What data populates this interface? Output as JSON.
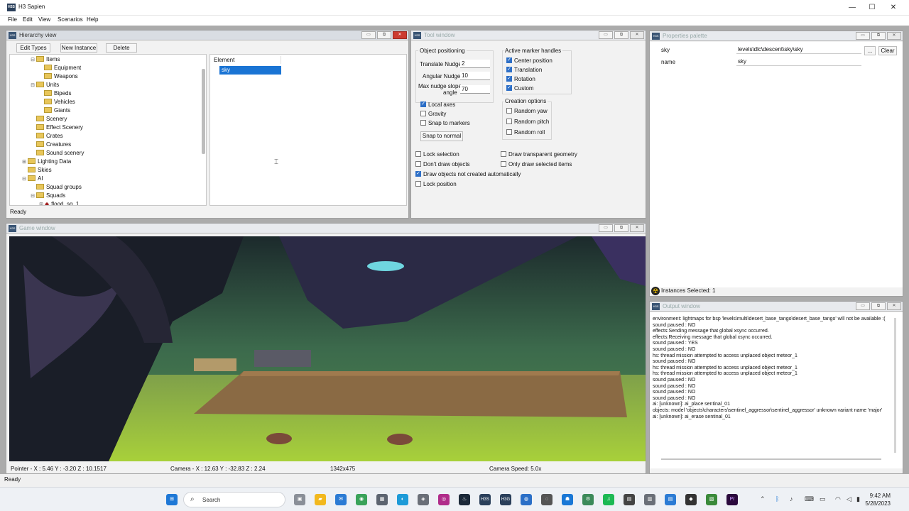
{
  "app": {
    "title": "H3 Sapien",
    "icon_text": "H3S",
    "ctrl_min": "—",
    "ctrl_max": "☐",
    "ctrl_close": "✕"
  },
  "menu": [
    "File",
    "Edit",
    "View",
    "Scenarios",
    "Help"
  ],
  "hierarchy": {
    "title": "Hierarchy view",
    "buttons": {
      "edit_types": "Edit Types",
      "new_instance": "New Instance",
      "delete": "Delete"
    },
    "tree": [
      {
        "label": "Items",
        "exp": "⊟"
      },
      {
        "label": "Equipment",
        "exp": ""
      },
      {
        "label": "Weapons",
        "exp": ""
      },
      {
        "label": "Units",
        "exp": "⊟"
      },
      {
        "label": "Bipeds",
        "exp": ""
      },
      {
        "label": "Vehicles",
        "exp": ""
      },
      {
        "label": "Giants",
        "exp": ""
      },
      {
        "label": "Scenery",
        "exp": ""
      },
      {
        "label": "Effect Scenery",
        "exp": ""
      },
      {
        "label": "Crates",
        "exp": ""
      },
      {
        "label": "Creatures",
        "exp": ""
      },
      {
        "label": "Sound scenery",
        "exp": ""
      },
      {
        "label": "Lighting Data",
        "exp": "⊞"
      },
      {
        "label": "Skies",
        "exp": ""
      },
      {
        "label": "AI",
        "exp": "⊟"
      },
      {
        "label": "Squad groups",
        "exp": ""
      },
      {
        "label": "Squads",
        "exp": "⊟"
      },
      {
        "label": "flood_sq_1",
        "exp": "⊞"
      }
    ],
    "element_header": "Element",
    "selected_element": "sky",
    "status": "Ready"
  },
  "tool": {
    "title": "Tool window",
    "object_positioning": "Object positioning",
    "translate_nudge_label": "Translate Nudge",
    "translate_nudge_value": "2",
    "angular_nudge_label": "Angular Nudge",
    "angular_nudge_value": "10",
    "max_nudge_label_1": "Max nudge slope",
    "max_nudge_label_2": "angle",
    "max_nudge_value": "70",
    "local_axes": "Local axes",
    "gravity": "Gravity",
    "snap_to_markers": "Snap to markers",
    "snap_to_normal": "Snap to normal",
    "active_marker_handles": "Active marker handles",
    "center_position": "Center position",
    "translation": "Translation",
    "rotation": "Rotation",
    "custom": "Custom",
    "creation_options": "Creation options",
    "random_yaw": "Random yaw",
    "random_pitch": "Random pitch",
    "random_roll": "Random roll",
    "lock_selection": "Lock selection",
    "dont_draw_objects": "Don't draw objects",
    "draw_objects_not_created": "Draw objects not created automatically",
    "lock_position": "Lock position",
    "draw_transparent_geometry": "Draw transparent geometry",
    "only_draw_selected": "Only draw selected items"
  },
  "properties": {
    "title": "Properties palette",
    "rows": [
      {
        "name": "sky",
        "value": "levels\\dlc\\descent\\sky\\sky"
      },
      {
        "name": "name",
        "value": "sky"
      }
    ],
    "browse_label": "...",
    "clear_label": "Clear",
    "instances_selected": "Instances Selected: 1"
  },
  "game": {
    "title": "Game window",
    "pointer": "Pointer - X : 5.46  Y : -3.20  Z : 10.1517",
    "camera": "Camera - X : 12.63  Y : -32.83  Z : 2.24",
    "resolution": "1342x475",
    "camera_speed": "Camera Speed: 5.0x"
  },
  "output": {
    "title": "Output window",
    "lines": [
      "environment: lightmaps for bsp 'levels\\multi\\desert_base_tango\\desert_base_tango' will not be available :(",
      "sound paused : NO",
      "effects:Sending message that global xsync occurred.",
      "effects:Receiving message that global xsync occurred.",
      "sound paused : YES",
      "sound paused : NO",
      "hs: thread mission attempted to access unplaced object meteor_1",
      "sound paused : NO",
      "hs: thread mission attempted to access unplaced object meteor_1",
      "hs: thread mission attempted to access unplaced object meteor_1",
      "sound paused : NO",
      "sound paused : NO",
      "sound paused : NO",
      "sound paused : NO",
      "ai: [unknown]: ai_place sentinal_01",
      "objects: model 'objects\\characters\\sentinel_aggressor\\sentinel_aggressor' unknown variant name 'major'",
      "ai: [unknown]: ai_erase sentinal_01"
    ]
  },
  "status_bar": "Ready",
  "taskbar": {
    "search": "Search",
    "time": "9:42 AM",
    "date": "5/28/2023",
    "h3s": "H3S",
    "h3g": "H3G",
    "premiere": "Pr"
  }
}
